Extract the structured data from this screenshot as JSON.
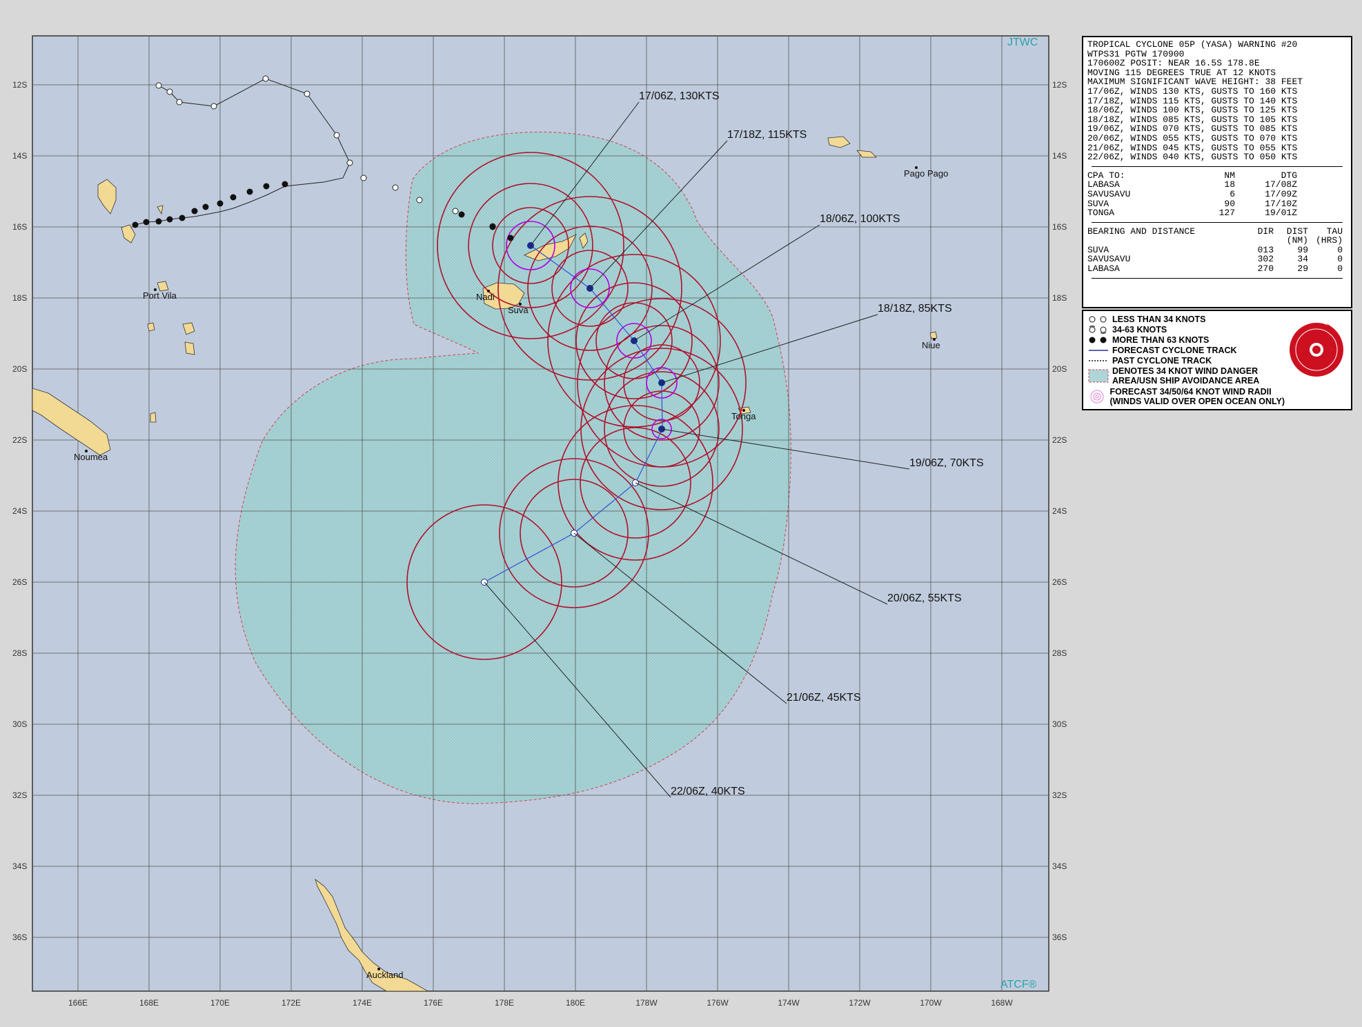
{
  "branding": {
    "top_right": "JTWC",
    "bottom_right": "ATCF®"
  },
  "axes": {
    "lon_labels": [
      "166E",
      "168E",
      "170E",
      "172E",
      "174E",
      "176E",
      "178E",
      "180E",
      "178W",
      "176W",
      "174W",
      "172W",
      "170W",
      "168W"
    ],
    "lat_labels": [
      "12S",
      "14S",
      "16S",
      "18S",
      "20S",
      "22S",
      "24S",
      "26S",
      "28S",
      "30S",
      "32S",
      "34S",
      "36S"
    ]
  },
  "places": [
    {
      "name": "Pago Pago"
    },
    {
      "name": "Port Vila"
    },
    {
      "name": "Nadi"
    },
    {
      "name": "Suva"
    },
    {
      "name": "Niue"
    },
    {
      "name": "Tonga"
    },
    {
      "name": "Noumea"
    },
    {
      "name": "Auckland"
    }
  ],
  "forecast_labels": [
    {
      "text": "17/06Z, 130KTS"
    },
    {
      "text": "17/18Z, 115KTS"
    },
    {
      "text": "18/06Z, 100KTS"
    },
    {
      "text": "18/18Z, 85KTS"
    },
    {
      "text": "19/06Z, 70KTS"
    },
    {
      "text": "20/06Z, 55KTS"
    },
    {
      "text": "21/06Z, 45KTS"
    },
    {
      "text": "22/06Z, 40KTS"
    }
  ],
  "warning": {
    "lines": [
      "TROPICAL CYCLONE 05P (YASA) WARNING #20",
      "WTPS31 PGTW 170900",
      "170600Z POSIT: NEAR 16.5S 178.8E",
      "MOVING 115 DEGREES TRUE AT 12 KNOTS",
      "MAXIMUM SIGNIFICANT WAVE HEIGHT: 38 FEET",
      "17/06Z, WINDS 130 KTS, GUSTS TO 160 KTS",
      "17/18Z, WINDS 115 KTS, GUSTS TO 140 KTS",
      "18/06Z, WINDS 100 KTS, GUSTS TO 125 KTS",
      "18/18Z, WINDS 085 KTS, GUSTS TO 105 KTS",
      "19/06Z, WINDS 070 KTS, GUSTS TO 085 KTS",
      "20/06Z, WINDS 055 KTS, GUSTS TO 070 KTS",
      "21/06Z, WINDS 045 KTS, GUSTS TO 055 KTS",
      "22/06Z, WINDS 040 KTS, GUSTS TO 050 KTS"
    ]
  },
  "cpa": {
    "header": [
      "CPA TO:",
      "NM",
      "DTG"
    ],
    "rows": [
      [
        "LABASA",
        "18",
        "17/08Z"
      ],
      [
        "SAVUSAVU",
        "6",
        "17/09Z"
      ],
      [
        "SUVA",
        "90",
        "17/10Z"
      ],
      [
        "TONGA",
        "127",
        "19/01Z"
      ]
    ]
  },
  "bearing": {
    "header": [
      "BEARING AND DISTANCE",
      "DIR",
      "DIST",
      "TAU"
    ],
    "subheader": [
      "",
      "",
      "(NM)",
      "(HRS)"
    ],
    "rows": [
      [
        "SUVA",
        "013",
        "99",
        "0"
      ],
      [
        "SAVUSAVU",
        "302",
        "34",
        "0"
      ],
      [
        "LABASA",
        "270",
        "29",
        "0"
      ]
    ]
  },
  "legend": {
    "items": [
      {
        "label": "LESS THAN 34 KNOTS",
        "icon": "hollow-storm-icon"
      },
      {
        "label": "34-63 KNOTS",
        "icon": "open-storm-icon"
      },
      {
        "label": "MORE THAN 63 KNOTS",
        "icon": "filled-storm-icon"
      },
      {
        "label": "FORECAST CYCLONE TRACK",
        "icon": "solid-line-icon"
      },
      {
        "label": "PAST CYCLONE TRACK",
        "icon": "dotted-line-icon"
      },
      {
        "label": "DENOTES 34 KNOT WIND DANGER",
        "label2": "AREA/USN SHIP AVOIDANCE AREA",
        "icon": "hatched-area-icon"
      },
      {
        "label": "FORECAST 34/50/64 KNOT WIND RADII",
        "label2": "(WINDS VALID OVER OPEN OCEAN ONLY)",
        "icon": "wind-radii-icon"
      }
    ],
    "seal_color": "#cc1020"
  },
  "colors": {
    "ocean": "#c0ccdd",
    "land": "#f2d994",
    "danger_fill": "#a8d4d4",
    "radii": "#b0102a",
    "track": "#1a2a8a",
    "inner_radii": "#b000e0"
  }
}
